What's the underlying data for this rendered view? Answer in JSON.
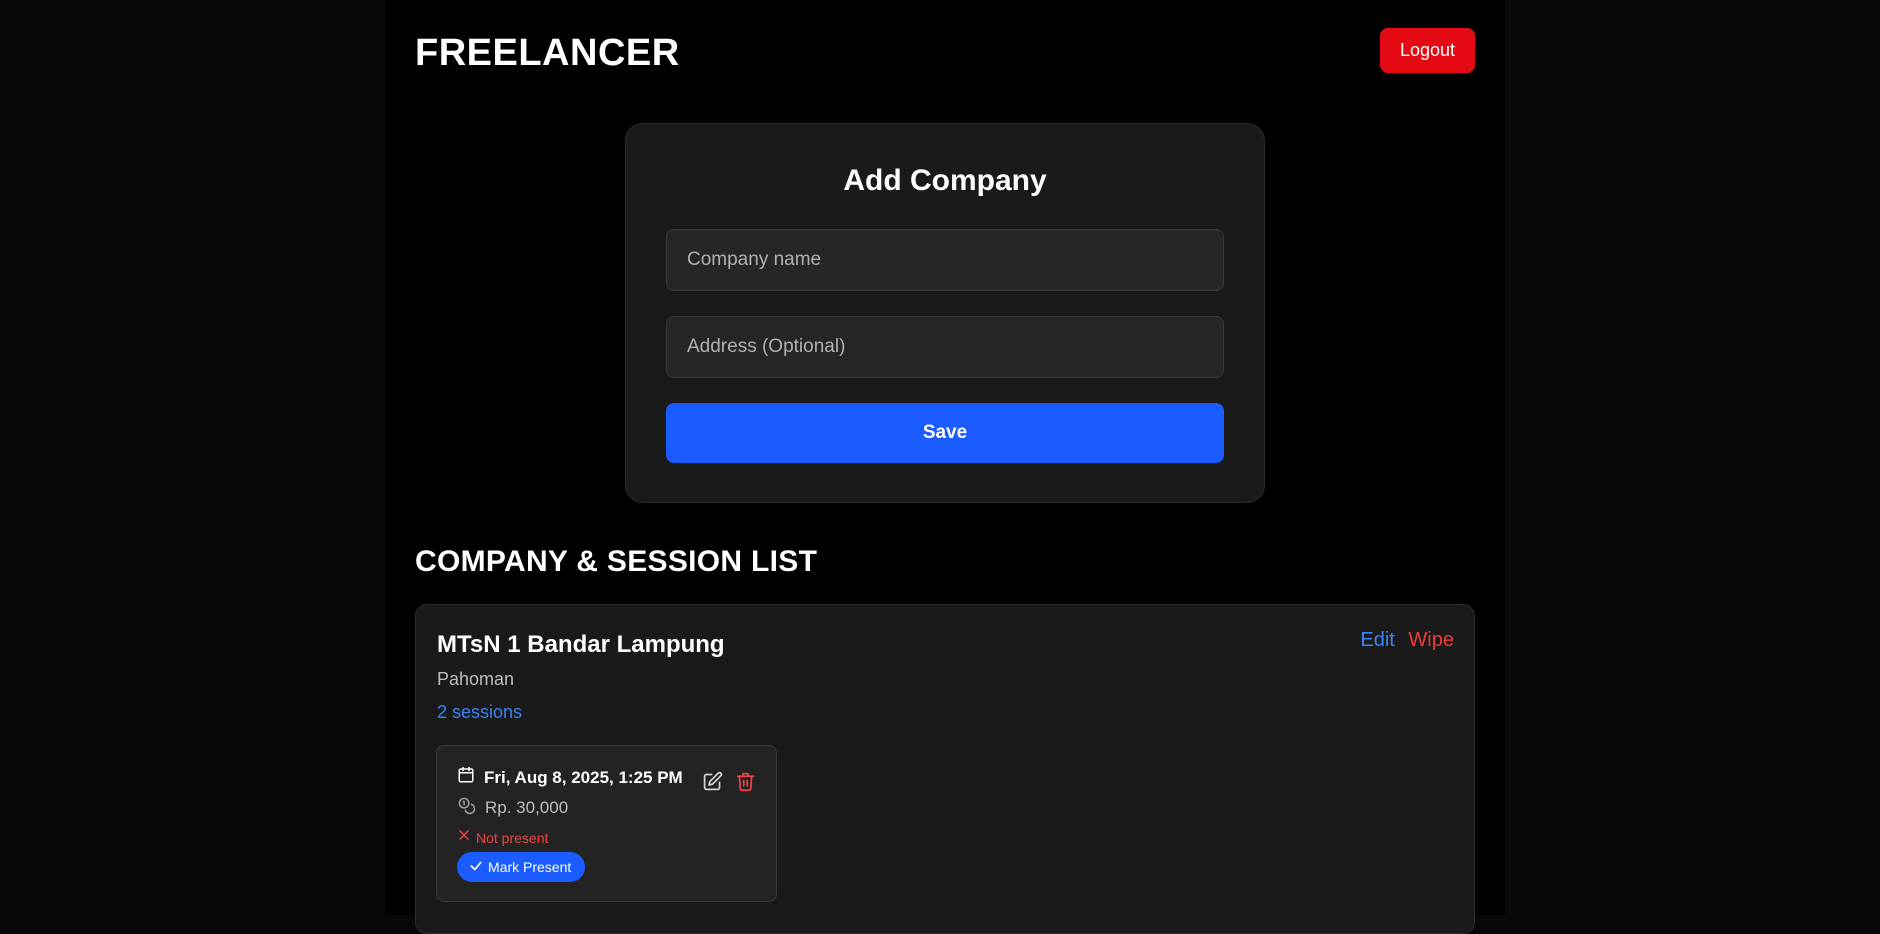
{
  "header": {
    "brand": "FREELANCER",
    "logout_label": "Logout"
  },
  "add_company": {
    "title": "Add Company",
    "name_placeholder": "Company name",
    "name_value": "",
    "address_placeholder": "Address (Optional)",
    "address_value": "",
    "save_label": "Save"
  },
  "list": {
    "heading": "COMPANY & SESSION LIST",
    "companies": [
      {
        "name": "MTsN 1 Bandar Lampung",
        "address": "Pahoman",
        "session_count": "2 sessions",
        "edit_label": "Edit",
        "wipe_label": "Wipe",
        "sessions": [
          {
            "date": "Fri, Aug 8, 2025, 1:25 PM",
            "fee": "Rp. 30,000",
            "status": "Not present",
            "mark_label": "Mark Present"
          }
        ]
      }
    ]
  },
  "icons": {
    "calendar": "calendar-icon",
    "coins": "coins-icon",
    "status": "x-icon",
    "edit": "edit-icon",
    "delete": "trash-icon",
    "check": "check-icon"
  },
  "colors": {
    "accent": "#1a5cff",
    "danger": "#e50914",
    "link": "#3b82f6",
    "wipe": "#ef3b3b",
    "background": "#000000",
    "card": "#1a1a1a"
  }
}
